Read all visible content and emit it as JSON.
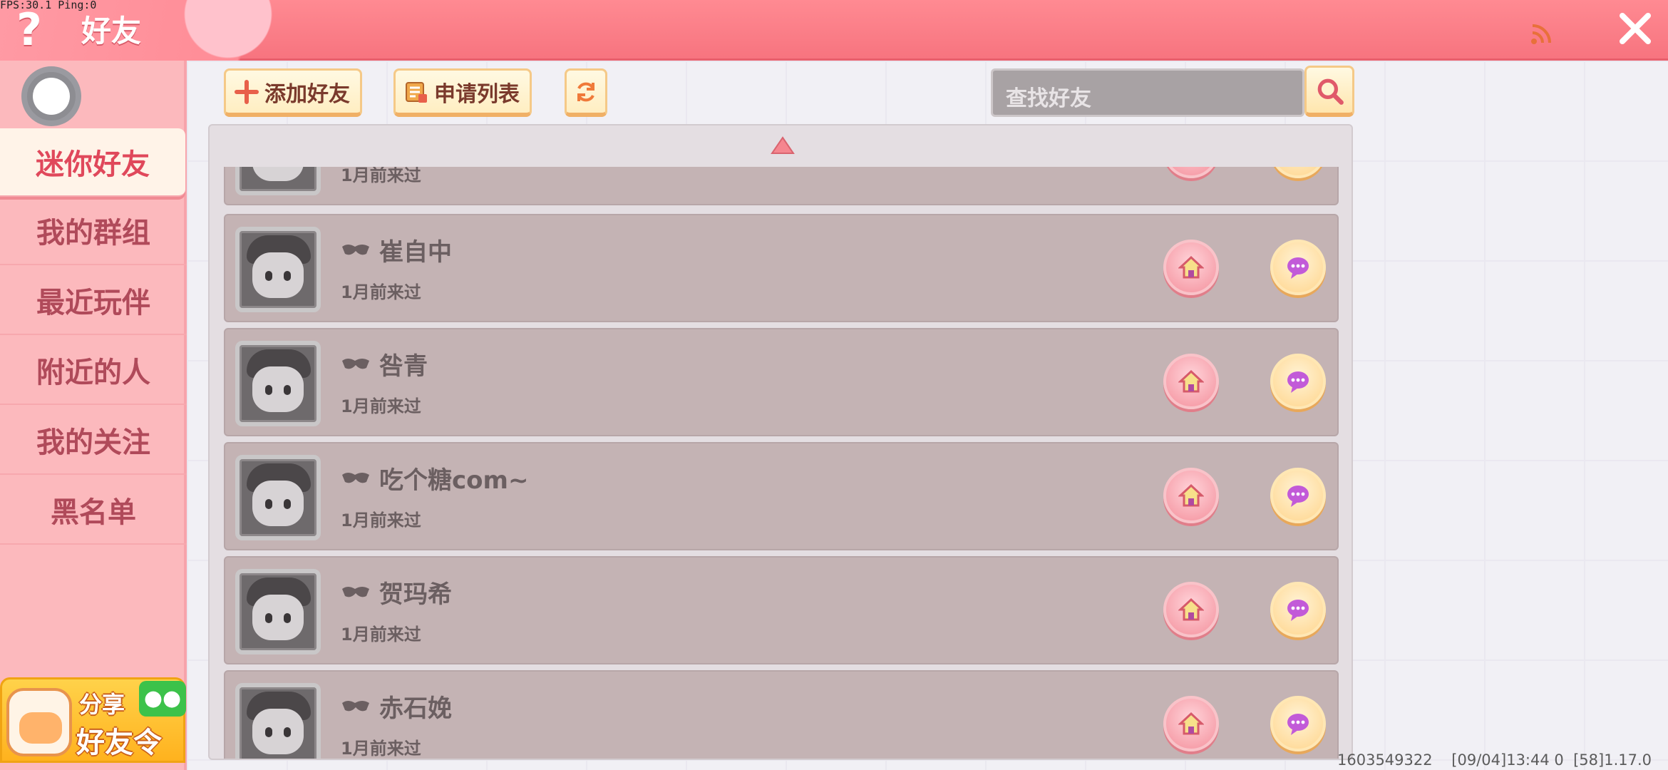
{
  "debug": {
    "fps": "FPS:30.1 Ping:0"
  },
  "header": {
    "title": "好友",
    "help_label": "?"
  },
  "sidebar": {
    "items": [
      {
        "label": "迷你好友",
        "active": true
      },
      {
        "label": "我的群组",
        "active": false
      },
      {
        "label": "最近玩伴",
        "active": false
      },
      {
        "label": "附近的人",
        "active": false
      },
      {
        "label": "我的关注",
        "active": false
      },
      {
        "label": "黑名单",
        "active": false
      }
    ],
    "share": {
      "line1": "分享",
      "line2": "好友令"
    }
  },
  "toolbar": {
    "add_friend_label": "添加好友",
    "request_list_label": "申请列表",
    "search_placeholder": "查找好友"
  },
  "friends": [
    {
      "name": "",
      "last_seen": "1月前来过"
    },
    {
      "name": "崔自中",
      "last_seen": "1月前来过"
    },
    {
      "name": "咎青",
      "last_seen": "1月前来过"
    },
    {
      "name": "吃个糖com~",
      "last_seen": "1月前来过"
    },
    {
      "name": "贺玛希",
      "last_seen": "1月前来过"
    },
    {
      "name": "赤石娩",
      "last_seen": "1月前来过"
    }
  ],
  "footer": {
    "info": "1603549322    [09/04]13:44 0  [58]1.17.0"
  },
  "colors": {
    "header": "#f7747f",
    "sidebar": "#fcb9bd",
    "row": "#c4b3b4",
    "active_text": "#e0485b"
  }
}
